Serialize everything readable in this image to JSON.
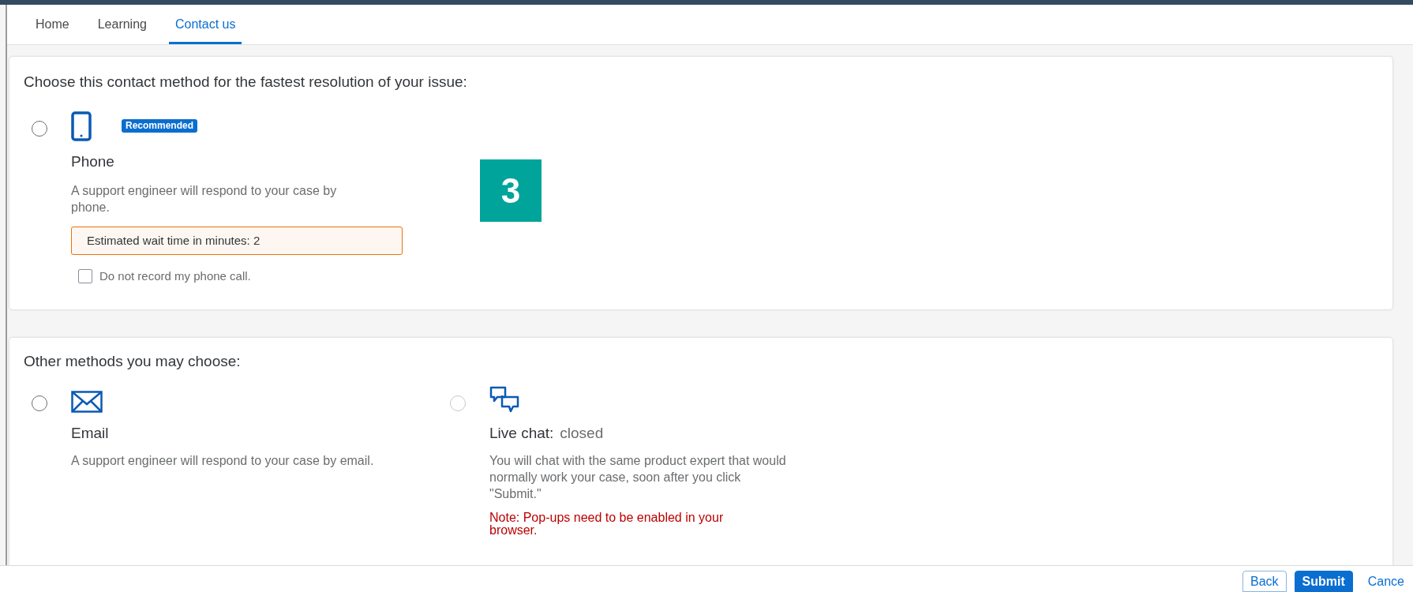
{
  "tabs": [
    {
      "label": "Home",
      "selected": false
    },
    {
      "label": "Learning",
      "selected": false
    },
    {
      "label": "Contact us",
      "selected": true
    }
  ],
  "primary": {
    "heading": "Choose this contact method for the fastest resolution of your issue:",
    "option": {
      "kind": "phone",
      "selected": false,
      "badge": "Recommended",
      "title": "Phone",
      "description": "A support engineer will respond to your case by phone.",
      "notice": "Estimated wait time in minutes: 2",
      "checkbox": {
        "label": "Do not record my phone call.",
        "checked": false
      }
    }
  },
  "step_marker": "3",
  "others": {
    "heading": "Other methods you may choose:",
    "options": [
      {
        "kind": "email",
        "selected": false,
        "disabled": false,
        "title": "Email",
        "description": "A support engineer will respond to your case by email."
      },
      {
        "kind": "chat",
        "selected": false,
        "disabled": true,
        "title": "Live chat:",
        "status": "closed",
        "description": "You will chat with the same product expert that would normally work your case, soon after you click \"Submit.\"",
        "note": "Note: Pop-ups need to be enabled in your browser."
      }
    ]
  },
  "footer": {
    "buttons": [
      {
        "label": "Back",
        "kind": "secondary"
      },
      {
        "label": "Submit",
        "kind": "primary"
      },
      {
        "label": "Cance",
        "kind": "link"
      }
    ]
  }
}
